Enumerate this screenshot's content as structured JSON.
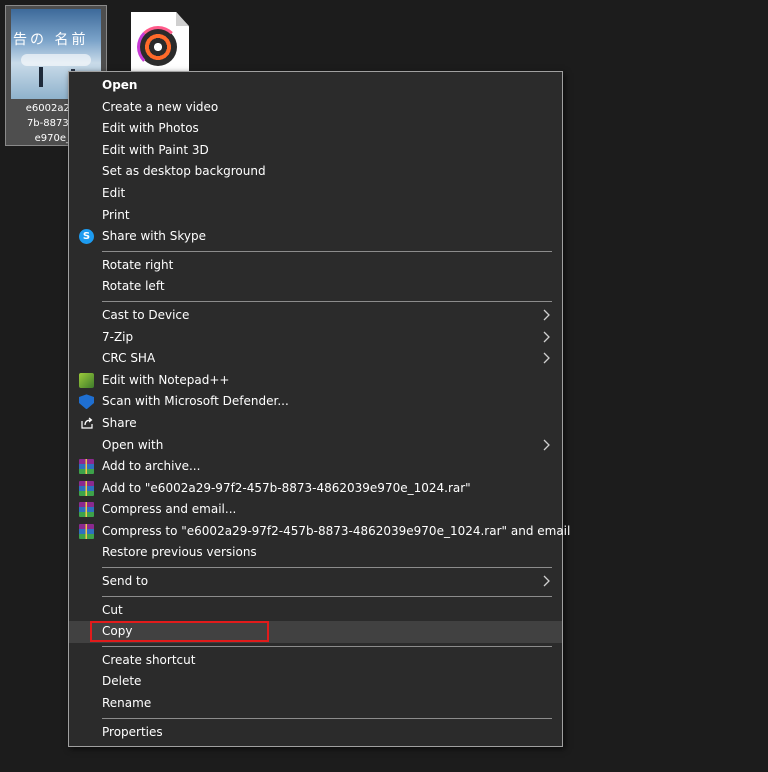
{
  "desktop": {
    "selected_file_label": "e6002a29-9\n7b-8873-48\ne970e_1",
    "thumbnail_text": "告の 名前"
  },
  "menu": {
    "items": [
      {
        "label": "Open",
        "bold": true,
        "icon": null,
        "submenu": false
      },
      {
        "label": "Create a new video",
        "icon": null,
        "submenu": false
      },
      {
        "label": "Edit with Photos",
        "icon": null,
        "submenu": false
      },
      {
        "label": "Edit with Paint 3D",
        "icon": null,
        "submenu": false
      },
      {
        "label": "Set as desktop background",
        "icon": null,
        "submenu": false
      },
      {
        "label": "Edit",
        "icon": null,
        "submenu": false
      },
      {
        "label": "Print",
        "icon": null,
        "submenu": false
      },
      {
        "label": "Share with Skype",
        "icon": "skype-icon",
        "submenu": false
      },
      {
        "label": "Rotate right",
        "icon": null,
        "submenu": false
      },
      {
        "label": "Rotate left",
        "icon": null,
        "submenu": false
      },
      {
        "label": "Cast to Device",
        "icon": null,
        "submenu": true
      },
      {
        "label": "7-Zip",
        "icon": null,
        "submenu": true
      },
      {
        "label": "CRC SHA",
        "icon": null,
        "submenu": true
      },
      {
        "label": "Edit with Notepad++",
        "icon": "notepad-plus-plus-icon",
        "submenu": false
      },
      {
        "label": "Scan with Microsoft Defender...",
        "icon": "defender-shield-icon",
        "submenu": false
      },
      {
        "label": "Share",
        "icon": "share-icon",
        "submenu": false
      },
      {
        "label": "Open with",
        "icon": null,
        "submenu": true
      },
      {
        "label": "Add to archive...",
        "icon": "winrar-icon",
        "submenu": false
      },
      {
        "label": "Add to \"e6002a29-97f2-457b-8873-4862039e970e_1024.rar\"",
        "icon": "winrar-icon",
        "submenu": false
      },
      {
        "label": "Compress and email...",
        "icon": "winrar-icon",
        "submenu": false
      },
      {
        "label": "Compress to \"e6002a29-97f2-457b-8873-4862039e970e_1024.rar\" and email",
        "icon": "winrar-icon",
        "submenu": false
      },
      {
        "label": "Restore previous versions",
        "icon": null,
        "submenu": false
      },
      {
        "label": "Send to",
        "icon": null,
        "submenu": true
      },
      {
        "label": "Cut",
        "icon": null,
        "submenu": false
      },
      {
        "label": "Copy",
        "icon": null,
        "submenu": false,
        "hovered": true,
        "highlighted": true
      },
      {
        "label": "Create shortcut",
        "icon": null,
        "submenu": false
      },
      {
        "label": "Delete",
        "icon": null,
        "submenu": false
      },
      {
        "label": "Rename",
        "icon": null,
        "submenu": false
      },
      {
        "label": "Properties",
        "icon": null,
        "submenu": false
      }
    ]
  },
  "colors": {
    "menu_background": "#2b2b2b",
    "hover_background": "#414141",
    "highlight_border": "#e21b1b",
    "text": "#ffffff"
  }
}
